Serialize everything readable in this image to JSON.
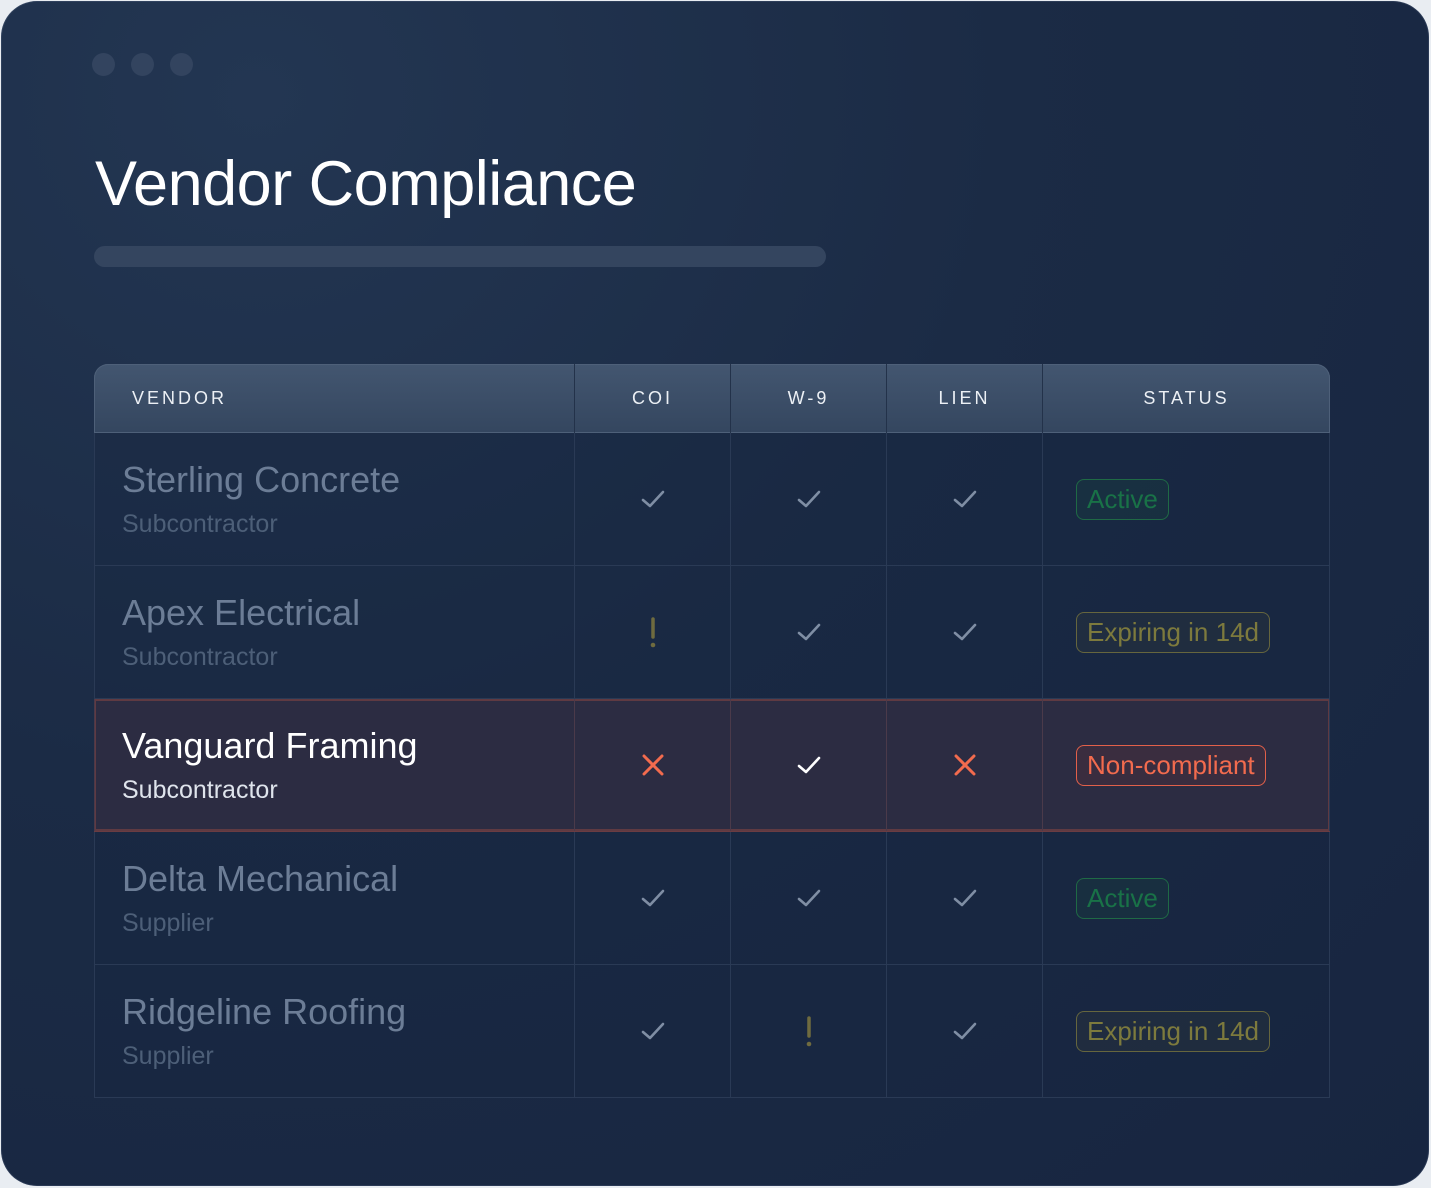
{
  "window": {
    "controls": [
      "close-dot",
      "minimize-dot",
      "maximize-dot"
    ],
    "title": "Vendor Compliance"
  },
  "table": {
    "columns": [
      "VENDOR",
      "COI",
      "W-9",
      "LIEN",
      "STATUS"
    ],
    "rows": [
      {
        "name": "Sterling Concrete",
        "type": "Subcontractor",
        "coi": "check",
        "w9": "check",
        "lien": "check",
        "status": "Active",
        "status_kind": "active",
        "highlighted": false
      },
      {
        "name": "Apex Electrical",
        "type": "Subcontractor",
        "coi": "warning",
        "w9": "check",
        "lien": "check",
        "status": "Expiring in 14d",
        "status_kind": "expiring",
        "highlighted": false
      },
      {
        "name": "Vanguard Framing",
        "type": "Subcontractor",
        "coi": "cross",
        "w9": "check",
        "lien": "cross",
        "status": "Non-compliant",
        "status_kind": "noncompliant",
        "highlighted": true
      },
      {
        "name": "Delta Mechanical",
        "type": "Supplier",
        "coi": "check",
        "w9": "check",
        "lien": "check",
        "status": "Active",
        "status_kind": "active",
        "highlighted": false
      },
      {
        "name": "Ridgeline Roofing",
        "type": "Supplier",
        "coi": "check",
        "w9": "warning",
        "lien": "check",
        "status": "Expiring in 14d",
        "status_kind": "expiring",
        "highlighted": false
      }
    ]
  },
  "colors": {
    "check_dim": "#7f8ea4",
    "check_bright": "#ffffff",
    "warning": "#6f6b3f",
    "cross": "#f26b4e"
  }
}
